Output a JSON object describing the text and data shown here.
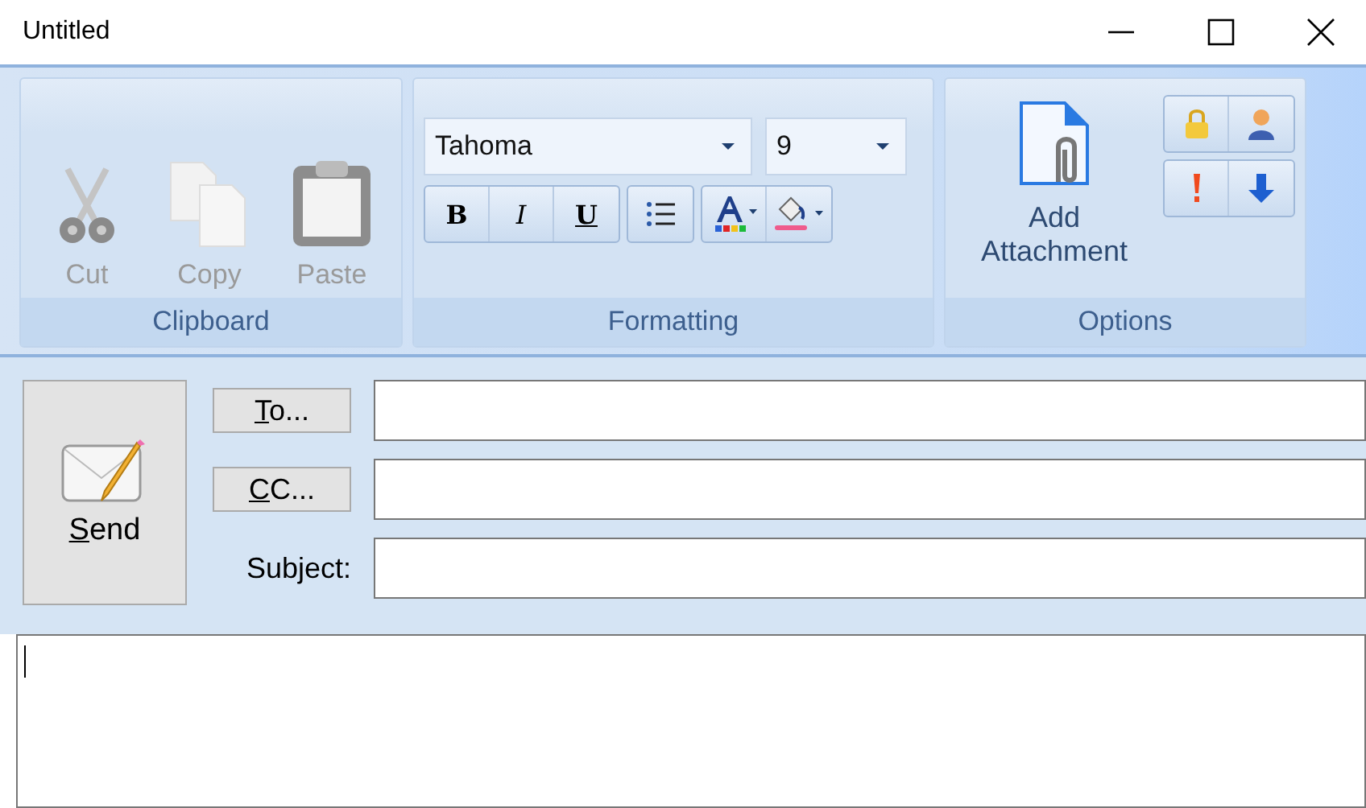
{
  "window": {
    "title": "Untitled"
  },
  "ribbon": {
    "groups": [
      {
        "kind": "clipboard",
        "label": "Clipboard",
        "buttons": [
          {
            "label": "Cut",
            "kind": "cut",
            "disabled": true
          },
          {
            "label": "Copy",
            "kind": "copy",
            "disabled": true
          },
          {
            "label": "Paste",
            "kind": "paste",
            "disabled": true
          }
        ]
      },
      {
        "kind": "formatting",
        "label": "Formatting",
        "font": "Tahoma",
        "size": "9",
        "styles": [
          {
            "label": "B",
            "kind": "bold"
          },
          {
            "label": "I",
            "kind": "italic"
          },
          {
            "label": "U",
            "kind": "underline"
          }
        ]
      },
      {
        "kind": "options",
        "label": "Options",
        "attach": {
          "line1": "Add",
          "line2": "Attachment"
        }
      }
    ]
  },
  "compose": {
    "send": {
      "label": "Send",
      "underline_first": true
    },
    "fields": [
      {
        "kind": "button",
        "label": "To...",
        "underline_first": true
      },
      {
        "kind": "button",
        "label": "CC...",
        "underline_first": true
      },
      {
        "kind": "label",
        "label": "Subject:",
        "underline_first": false
      }
    ]
  }
}
